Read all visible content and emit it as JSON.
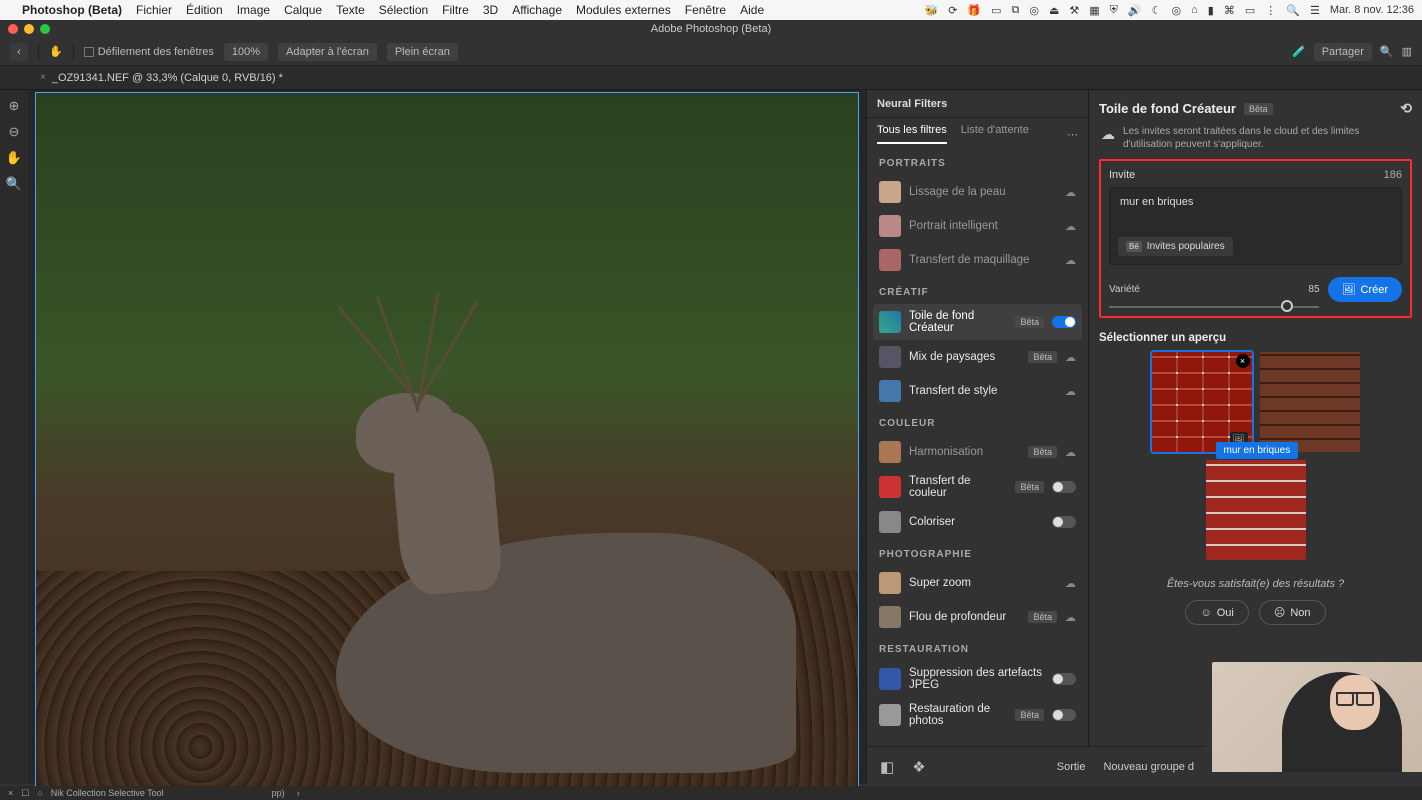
{
  "menubar": {
    "app": "Photoshop (Beta)",
    "items": [
      "Fichier",
      "Édition",
      "Image",
      "Calque",
      "Texte",
      "Sélection",
      "Filtre",
      "3D",
      "Affichage",
      "Modules externes",
      "Fenêtre",
      "Aide"
    ],
    "clock": "Mar. 8 nov.  12:36"
  },
  "window_title": "Adobe Photoshop (Beta)",
  "toolbar": {
    "scroll_windows": "Défilement des fenêtres",
    "zoom": "100%",
    "fit": "Adapter à l'écran",
    "full": "Plein écran",
    "share": "Partager"
  },
  "tab": {
    "name": "_OZ91341.NEF @ 33,3% (Calque 0, RVB/16) *"
  },
  "neural": {
    "header": "Neural Filters",
    "tab_all": "Tous les filtres",
    "tab_wait": "Liste d'attente",
    "cats": {
      "portraits": "PORTRAITS",
      "creatif": "CRÉATIF",
      "couleur": "COULEUR",
      "photo": "PHOTOGRAPHIE",
      "resto": "RESTAURATION"
    },
    "beta": "Bêta",
    "filters": {
      "skin": "Lissage de la peau",
      "smartportrait": "Portrait intelligent",
      "makeup": "Transfert de maquillage",
      "backdrop": "Toile de fond Créateur",
      "landscape": "Mix de paysages",
      "style": "Transfert de style",
      "harmo": "Harmonisation",
      "colortransfer": "Transfert de couleur",
      "colorize": "Coloriser",
      "superzoom": "Super zoom",
      "depthblur": "Flou de profondeur",
      "jpeg": "Suppression des artefacts JPEG",
      "photorestore": "Restauration de photos"
    }
  },
  "settings": {
    "title": "Toile de fond Créateur",
    "cloud_note": "Les invites seront traitées dans le cloud et des limites d'utilisation peuvent s'appliquer.",
    "invite_label": "Invite",
    "char_count": "186",
    "prompt": "mur en briques",
    "popular": "Invites populaires",
    "variety": "Variété",
    "variety_val": "85",
    "create": "Créer",
    "select_preview": "Sélectionner un aperçu",
    "tooltip": "mur en briques",
    "satisfied": "Êtes-vous satisfait(e) des résultats ?",
    "yes": "Oui",
    "no": "Non"
  },
  "output": {
    "sortie": "Sortie",
    "value": "Nouveau groupe d"
  },
  "status": {
    "nik": "Nik Collection Selective Tool",
    "pp": "pp)"
  }
}
